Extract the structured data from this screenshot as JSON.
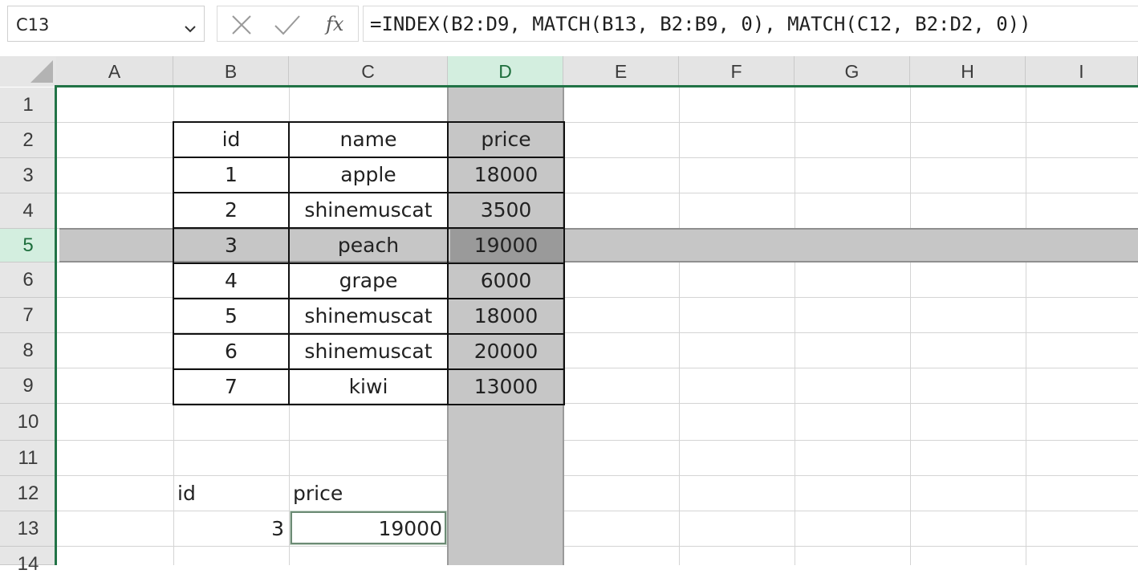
{
  "formula_bar": {
    "name_box": "C13",
    "fx_label": "fx",
    "formula": "=INDEX(B2:D9, MATCH(B13, B2:B9, 0), MATCH(C12, B2:D2, 0))"
  },
  "columns": [
    "A",
    "B",
    "C",
    "D",
    "E",
    "F",
    "G",
    "H",
    "I"
  ],
  "rows": [
    "1",
    "2",
    "3",
    "4",
    "5",
    "6",
    "7",
    "8",
    "9",
    "10",
    "11",
    "12",
    "13",
    "14"
  ],
  "active_column": "D",
  "active_row": "5",
  "table": {
    "headers": [
      "id",
      "name",
      "price"
    ],
    "rows": [
      [
        "1",
        "apple",
        "18000"
      ],
      [
        "2",
        "shinemuscat",
        "3500"
      ],
      [
        "3",
        "peach",
        "19000"
      ],
      [
        "4",
        "grape",
        "6000"
      ],
      [
        "5",
        "shinemuscat",
        "18000"
      ],
      [
        "6",
        "shinemuscat",
        "20000"
      ],
      [
        "7",
        "kiwi",
        "13000"
      ]
    ]
  },
  "lookup": {
    "id_label": "id",
    "price_label": "price",
    "id_value": "3",
    "price_value": "19000"
  },
  "colors": {
    "accent": "#217346",
    "highlight": "#c6c6c6",
    "active_header": "#d3eedf"
  }
}
